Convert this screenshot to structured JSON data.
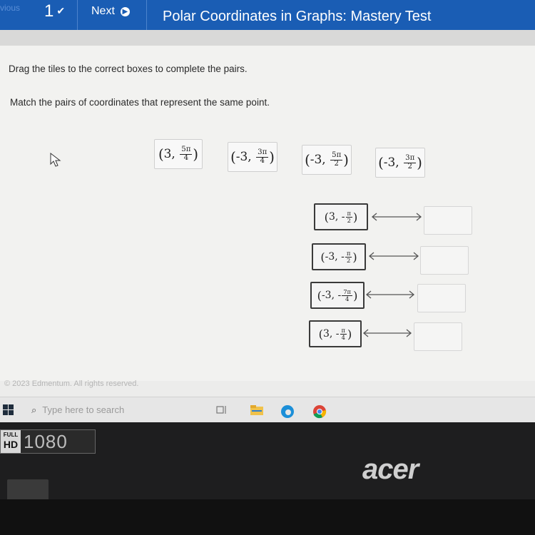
{
  "topbar": {
    "prev_label": "vious",
    "question_number": "1",
    "next_label": "Next",
    "title": "Polar Coordinates in Graphs: Mastery Test"
  },
  "instructions": {
    "line1": "Drag the tiles to the correct boxes to complete the pairs.",
    "line2": "Match the pairs of coordinates that represent the same point."
  },
  "tiles": [
    {
      "r": "3",
      "sign": "",
      "num": "5π",
      "den": "4"
    },
    {
      "r": "-3",
      "sign": "",
      "num": "3π",
      "den": "4"
    },
    {
      "r": "-3",
      "sign": "",
      "num": "5π",
      "den": "2"
    },
    {
      "r": "-3",
      "sign": "",
      "num": "3π",
      "den": "2"
    }
  ],
  "pairs": [
    {
      "r": "3",
      "sign": "-",
      "num": "π",
      "den": "2"
    },
    {
      "r": "-3",
      "sign": "-",
      "num": "π",
      "den": "2"
    },
    {
      "r": "-3",
      "sign": "-",
      "num": "7π",
      "den": "4"
    },
    {
      "r": "3",
      "sign": "-",
      "num": "π",
      "den": "4"
    }
  ],
  "footer": "© 2023 Edmentum. All rights reserved.",
  "taskbar": {
    "search_placeholder": "Type here to search"
  },
  "device": {
    "hd_full": "FULL",
    "hd_hd": "HD",
    "hd_res": "1080",
    "brand": "acer"
  },
  "colors": {
    "header_blue": "#1a5db4"
  }
}
